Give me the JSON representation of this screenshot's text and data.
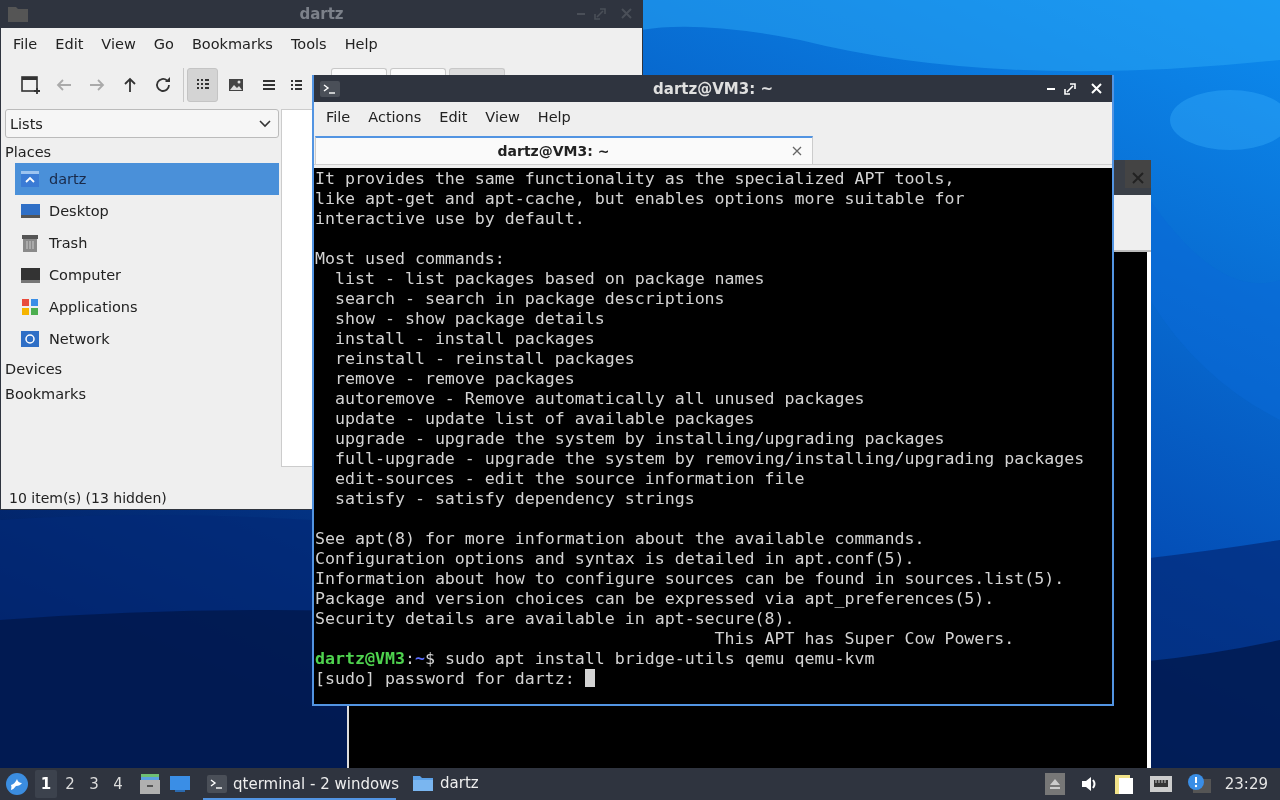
{
  "file_manager": {
    "title": "dartz",
    "menu": [
      "File",
      "Edit",
      "View",
      "Go",
      "Bookmarks",
      "Tools",
      "Help"
    ],
    "nav_buttons": [
      {
        "kind": "new-window",
        "disabled": false
      },
      {
        "kind": "back",
        "disabled": true
      },
      {
        "kind": "forward",
        "disabled": true
      },
      {
        "kind": "up",
        "disabled": false
      },
      {
        "kind": "reload",
        "disabled": false
      }
    ],
    "view_modes": [
      {
        "kind": "icons",
        "selected": true
      },
      {
        "kind": "thumbnails",
        "selected": false
      },
      {
        "kind": "compact",
        "selected": false
      },
      {
        "kind": "detailed",
        "selected": false
      }
    ],
    "sidebar": {
      "mode": "Lists",
      "sections": [
        {
          "title": "Places",
          "items": [
            {
              "label": "dartz",
              "kind": "home",
              "selected": true
            },
            {
              "label": "Desktop",
              "kind": "desktop",
              "selected": false
            },
            {
              "label": "Trash",
              "kind": "trash",
              "selected": false
            },
            {
              "label": "Computer",
              "kind": "computer",
              "selected": false
            },
            {
              "label": "Applications",
              "kind": "apps",
              "selected": false
            },
            {
              "label": "Network",
              "kind": "network",
              "selected": false
            }
          ]
        },
        {
          "title": "Devices"
        },
        {
          "title": "Bookmarks"
        }
      ]
    },
    "status_bar": "10 item(s) (13 hidden)"
  },
  "terminal": {
    "title": "dartz@VM3: ~",
    "menu": [
      "File",
      "Actions",
      "Edit",
      "View",
      "Help"
    ],
    "tabs": [
      {
        "label": "dartz@VM3: ~",
        "selected": true
      }
    ],
    "output": [
      [
        "It provides the same functionality as the specialized APT tools,",
        "like apt-get and apt-cache, but enables options more suitable for",
        "interactive use by default."
      ],
      [
        "Most used commands:",
        "  list - list packages based on package names",
        "  search - search in package descriptions",
        "  show - show package details",
        "  install - install packages",
        "  reinstall - reinstall packages",
        "  remove - remove packages",
        "  autoremove - Remove automatically all unused packages",
        "  update - update list of available packages",
        "  upgrade - upgrade the system by installing/upgrading packages",
        "  full-upgrade - upgrade the system by removing/installing/upgrading packages",
        "  edit-sources - edit the source information file",
        "  satisfy - satisfy dependency strings"
      ],
      [
        "See apt(8) for more information about the available commands.",
        "Configuration options and syntax is detailed in apt.conf(5).",
        "Information about how to configure sources can be found in sources.list(5).",
        "Package and version choices can be expressed via apt_preferences(5).",
        "Security details are available in apt-secure(8).",
        "                                        This APT has Super Cow Powers."
      ]
    ],
    "prompt": {
      "user": "dartz@VM3",
      "separator": ":",
      "path": "~",
      "symbol": "$",
      "command": "sudo apt install bridge-utils qemu qemu-kvm"
    },
    "input_line": "[sudo] password for dartz:"
  },
  "taskbar": {
    "desktops": [
      {
        "label": "1",
        "selected": true
      },
      {
        "label": "2",
        "selected": false
      },
      {
        "label": "3",
        "selected": false
      },
      {
        "label": "4",
        "selected": false
      }
    ],
    "tasks": [
      {
        "label": "qterminal - 2 windows",
        "kind": "terminal",
        "selected": true
      },
      {
        "label": "dartz",
        "kind": "folder",
        "selected": false
      }
    ],
    "clock": "23:29"
  }
}
